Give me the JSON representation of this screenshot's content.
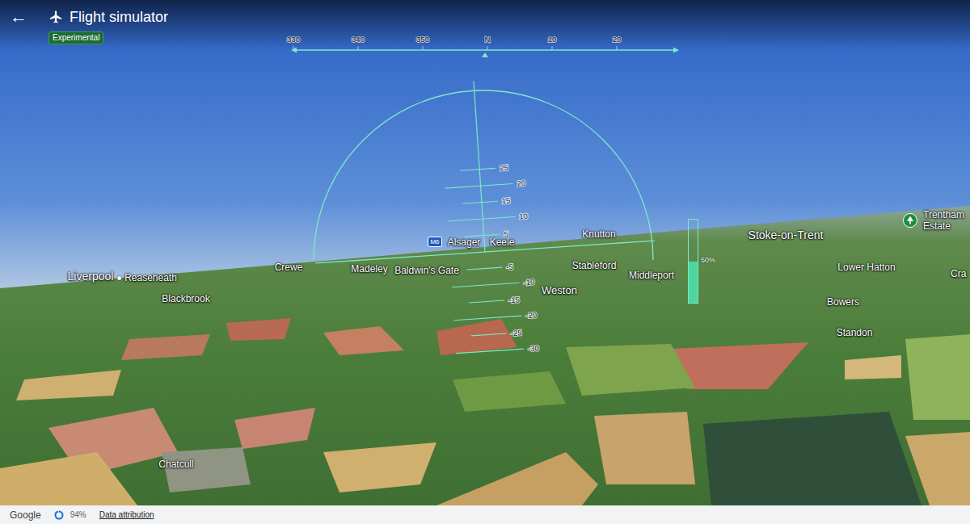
{
  "header": {
    "back": "←",
    "title": "Flight simulator",
    "badge": "Experimental"
  },
  "heading_tape": {
    "ticks": [
      "330",
      "340",
      "350",
      "N",
      "10",
      "20"
    ]
  },
  "pitch_ladder": {
    "ticks": [
      "25",
      "20",
      "15",
      "10",
      "5",
      "-5",
      "-10",
      "-15",
      "-20",
      "-25",
      "-30"
    ]
  },
  "throttle": {
    "level": 0.5,
    "reading": "50%"
  },
  "road_shield": "M6",
  "map_labels": [
    {
      "text": "Liverpool",
      "kind": "city"
    },
    {
      "text": "Reaseheath",
      "kind": "dot"
    },
    {
      "text": "Blackbrook",
      "kind": "town"
    },
    {
      "text": "Crewe",
      "kind": "town"
    },
    {
      "text": "Madeley",
      "kind": "town"
    },
    {
      "text": "Alsager",
      "kind": "town"
    },
    {
      "text": "Keele",
      "kind": "town"
    },
    {
      "text": "Baldwin's Gate",
      "kind": "town"
    },
    {
      "text": "Knutton",
      "kind": "town"
    },
    {
      "text": "Middleport",
      "kind": "town"
    },
    {
      "text": "Stableford",
      "kind": "town"
    },
    {
      "text": "Weston",
      "kind": "big"
    },
    {
      "text": "Stoke-on-Trent",
      "kind": "city"
    },
    {
      "text": "Lower Hatton",
      "kind": "town"
    },
    {
      "text": "Bowers",
      "kind": "town"
    },
    {
      "text": "Standon",
      "kind": "town"
    },
    {
      "text": "Trentham Estate",
      "kind": "poi"
    },
    {
      "text": "Cra",
      "kind": "edge"
    },
    {
      "text": "Chatcull",
      "kind": "town"
    }
  ],
  "footer": {
    "logo": "Google",
    "loading": {
      "level": 0.94,
      "reading": "94%"
    },
    "link": "Data attribution"
  }
}
